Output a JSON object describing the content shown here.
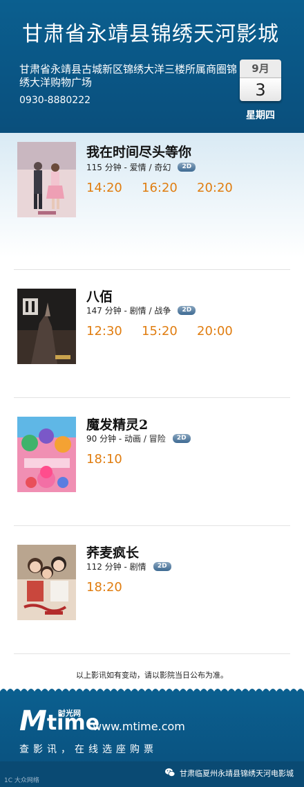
{
  "header": {
    "cinema_name": "甘肃省永靖县锦绣天河影城",
    "address": "甘肃省永靖县古城新区锦绣大洋三楼所属商圈锦绣大洋购物广场",
    "phone": "0930-8880222",
    "calendar": {
      "month": "9月",
      "day": "3",
      "weekday": "星期四"
    }
  },
  "movies": [
    {
      "title": "我在时间尽头等你",
      "meta": "115 分钟 - 爱情 / 奇幻",
      "format": "2D",
      "times": [
        "14:20",
        "16:20",
        "20:20"
      ]
    },
    {
      "title": "八佰",
      "meta": "147 分钟 - 剧情 / 战争",
      "format": "2D",
      "times": [
        "12:30",
        "15:20",
        "20:00"
      ]
    },
    {
      "title": "魔发精灵2",
      "meta": "90 分钟 - 动画 / 冒险",
      "format": "2D",
      "times": [
        "18:10"
      ]
    },
    {
      "title": "荞麦疯长",
      "meta": "112 分钟 - 剧情",
      "format": "2D",
      "times": [
        "18:20"
      ]
    }
  ],
  "notice": "以上影讯如有变动，请以影院当日公布为准。",
  "footer": {
    "logo_m": "M",
    "logo_word": "time",
    "logo_cn": "时光网",
    "site": "www.mtime.com",
    "slogan": "查影讯，在线选座购票",
    "corner_text": "1C 大众网络",
    "wechat_label": "甘肃临夏州永靖县锦绣天河电影城"
  },
  "colors": {
    "header_blue": "#0a5584",
    "showtime_orange": "#e07d10"
  }
}
